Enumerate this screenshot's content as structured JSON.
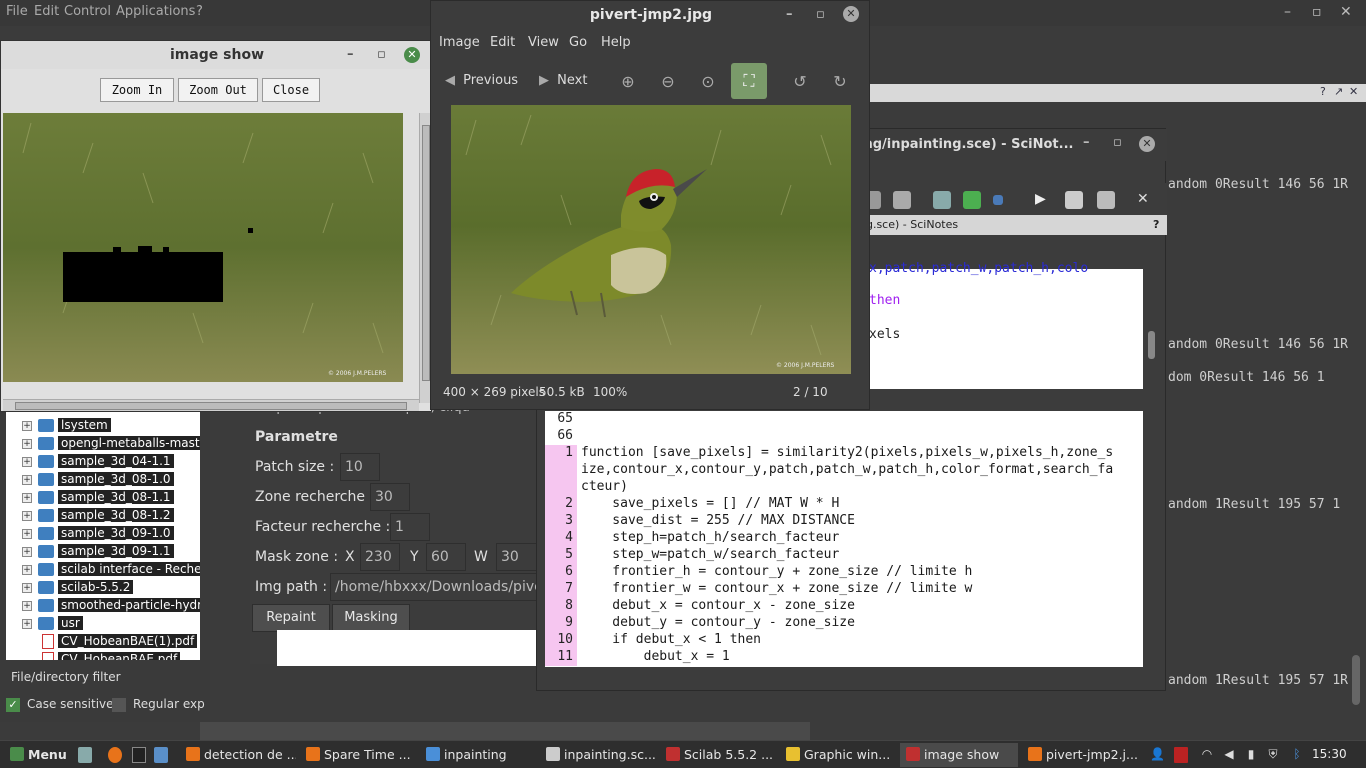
{
  "console": {
    "menu": [
      "File",
      "Edit",
      "Control",
      "Applications",
      "?"
    ],
    "header_buttons": [
      "?",
      "↗",
      "✕"
    ],
    "lines": [
      "andom  0Result 146 56 1R",
      "andom  0Result 146 56 1R",
      "dom  0Result 146 56 1",
      "andom  1Result 195 57 1",
      "andom  1Result 195 57 1R"
    ]
  },
  "scinotes": {
    "title": "ing/inpainting.sce) - SciNot...",
    "tab_title": "ng.sce) - SciNotes",
    "tab_help": "?",
    "partial_lines": [
      "x,patch,patch_w,patch_h,colo",
      "then",
      "xels"
    ],
    "lines": [
      {
        "num": "65",
        "text": "",
        "hl": false
      },
      {
        "num": "66",
        "text": "",
        "hl": false
      },
      {
        "num": "1",
        "text": "function [save_pixels] = similarity2(pixels,pixels_w,pixels_h,zone_s",
        "hl": true
      },
      {
        "num": "",
        "text": "ize,contour_x,contour_y,patch,patch_w,patch_h,color_format,search_fa",
        "hl": true
      },
      {
        "num": "",
        "text": "cteur)",
        "hl": true
      },
      {
        "num": "2",
        "text": "    save_pixels = [] // MAT W * H",
        "hl": true
      },
      {
        "num": "3",
        "text": "    save_dist = 255 // MAX DISTANCE",
        "hl": true
      },
      {
        "num": "4",
        "text": "    step_h=patch_h/search_facteur",
        "hl": true
      },
      {
        "num": "5",
        "text": "    step_w=patch_w/search_facteur",
        "hl": true
      },
      {
        "num": "6",
        "text": "    frontier_h = contour_y + zone_size // limite h",
        "hl": true
      },
      {
        "num": "7",
        "text": "    frontier_w = contour_x + zone_size // limite w",
        "hl": true
      },
      {
        "num": "8",
        "text": "    debut_x = contour_x - zone_size",
        "hl": true
      },
      {
        "num": "9",
        "text": "    debut_y = contour_y - zone_size",
        "hl": true
      },
      {
        "num": "10",
        "text": "    if debut_x < 1 then",
        "hl": true
      },
      {
        "num": "11",
        "text": "        debut_x = 1",
        "hl": true
      }
    ]
  },
  "filebrowser": {
    "items": [
      {
        "name": "lsystem",
        "type": "folder"
      },
      {
        "name": "opengl-metaballs-master",
        "type": "folder"
      },
      {
        "name": "sample_3d_04-1.1",
        "type": "folder"
      },
      {
        "name": "sample_3d_08-1.0",
        "type": "folder"
      },
      {
        "name": "sample_3d_08-1.1",
        "type": "folder"
      },
      {
        "name": "sample_3d_08-1.2",
        "type": "folder"
      },
      {
        "name": "sample_3d_09-1.0",
        "type": "folder"
      },
      {
        "name": "sample_3d_09-1.1",
        "type": "folder"
      },
      {
        "name": "scilab interface - Recherch",
        "type": "folder"
      },
      {
        "name": "scilab-5.5.2",
        "type": "folder"
      },
      {
        "name": "smoothed-particle-hydrod",
        "type": "folder"
      },
      {
        "name": "usr",
        "type": "folder"
      },
      {
        "name": "CV_HobeanBAE(1).pdf",
        "type": "pdf"
      },
      {
        "name": "CV_HobeanBAE.pdf",
        "type": "pdf"
      }
    ],
    "filter_label": "File/directory filter",
    "case_sensitive_label": "Case sensitive",
    "regex_label": "Regular exp"
  },
  "gui": {
    "hint": "Step : Cliquez sur masquer, cliqu",
    "section_title": "Parametre",
    "patch_size_label": "Patch size :",
    "patch_size_value": "10",
    "zone_label": "Zone recherche :",
    "zone_value": "30",
    "facteur_label": "Facteur recherche :",
    "facteur_value": "1",
    "mask_label": "Mask zone :",
    "x_label": "X",
    "x_value": "230",
    "y_label": "Y",
    "y_value": "60",
    "w_label": "W",
    "w_value": "30",
    "img_path_label": "Img path :",
    "img_path_value": "/home/hbxxx/Downloads/piver",
    "repaint_label": "Repaint",
    "masking_label": "Masking"
  },
  "imgshow": {
    "title": "image show",
    "zoom_in": "Zoom In",
    "zoom_out": "Zoom Out",
    "close": "Close",
    "copyright": "© 2006 J.M.PELERS"
  },
  "viewer": {
    "title": "pivert-jmp2.jpg",
    "menu": [
      "Image",
      "Edit",
      "View",
      "Go",
      "Help"
    ],
    "previous": "Previous",
    "next": "Next",
    "dimensions": "400 × 269 pixels",
    "filesize": "50.5 kB",
    "zoom": "100%",
    "position": "2 / 10",
    "copyright": "© 2006 J.M.PELERS"
  },
  "taskbar": {
    "menu_label": "Menu",
    "tasks": [
      {
        "label": "detection de ...",
        "icon_color": "#e8731a",
        "active": false
      },
      {
        "label": "Spare Time ...",
        "icon_color": "#e8731a",
        "active": false
      },
      {
        "label": "inpainting",
        "icon_color": "#4a8fd8",
        "active": false
      },
      {
        "label": "inpainting.sc...",
        "icon_color": "#cccccc",
        "active": false
      },
      {
        "label": "Scilab 5.5.2 ...",
        "icon_color": "#c03030",
        "active": false
      },
      {
        "label": "Graphic win...",
        "icon_color": "#e8c030",
        "active": false
      },
      {
        "label": "image show",
        "icon_color": "#c03030",
        "active": true
      },
      {
        "label": "pivert-jmp2.j...",
        "icon_color": "#e8731a",
        "active": false
      }
    ],
    "clock": "15:30"
  },
  "colors": {
    "accent_green": "#4a8c4a",
    "highlight_pink": "#f6c6f0"
  }
}
